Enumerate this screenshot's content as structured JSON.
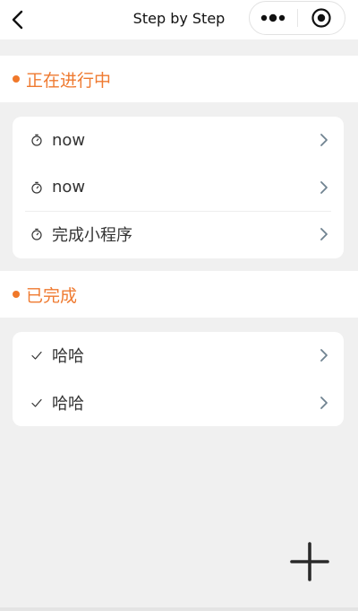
{
  "navbar": {
    "title": "Step by Step",
    "back_icon": "chevron-left-icon",
    "more_icon": "more-dots-icon",
    "close_icon": "target-circle-icon"
  },
  "in_progress": {
    "title": "正在进行中",
    "items": [
      {
        "label": "now",
        "icon": "timer-icon"
      },
      {
        "label": "now",
        "icon": "timer-icon"
      },
      {
        "label": "完成小程序",
        "icon": "timer-icon"
      }
    ]
  },
  "completed": {
    "title": "已完成",
    "items": [
      {
        "label": "哈哈",
        "icon": "check-icon"
      },
      {
        "label": "哈哈",
        "icon": "check-icon"
      }
    ]
  },
  "fab": {
    "icon": "plus-icon"
  },
  "colors": {
    "accent": "#ef7a30",
    "background": "#f0f0f0",
    "card": "#ffffff",
    "chevron": "#6f8290"
  }
}
